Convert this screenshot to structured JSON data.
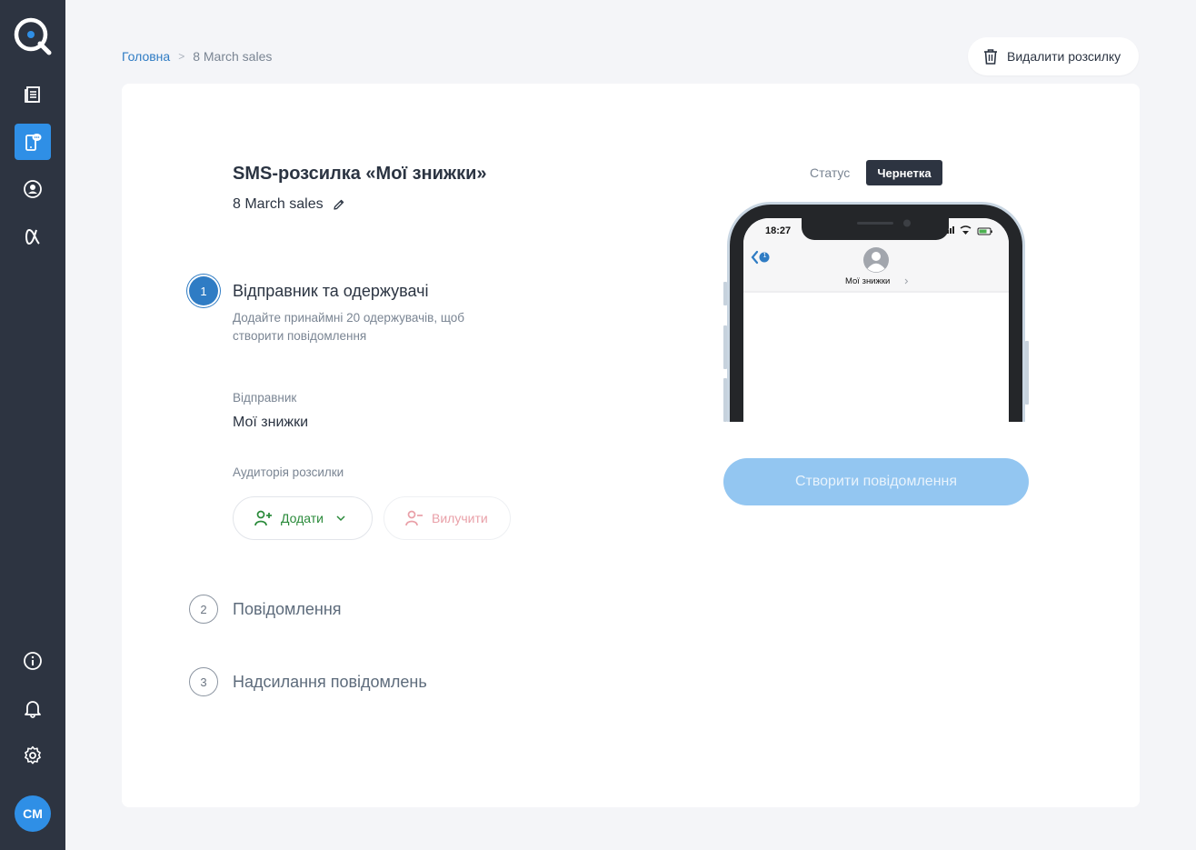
{
  "sidebar": {
    "items": [
      {
        "name": "campaigns",
        "icon": "newspaper-icon"
      },
      {
        "name": "sms",
        "icon": "sms-phone-icon",
        "active": true
      },
      {
        "name": "contacts",
        "icon": "contacts-icon"
      },
      {
        "name": "alpha",
        "icon": "alpha-icon"
      }
    ],
    "bottom": [
      {
        "name": "info",
        "icon": "info-icon"
      },
      {
        "name": "notifications",
        "icon": "bell-icon"
      },
      {
        "name": "settings",
        "icon": "gear-icon"
      }
    ],
    "avatar": "CM",
    "accent": "#2f8fe6"
  },
  "breadcrumb": {
    "home": "Головна",
    "current": "8 March sales"
  },
  "header": {
    "delete_label": "Видалити розсилку"
  },
  "campaign": {
    "title": "SMS-розсилка «Мої знижки»",
    "name": "8 March sales"
  },
  "steps": [
    {
      "number": "1",
      "title": "Відправник та одержувачі",
      "description": "Додайте принаймні 20 одержувачів, щоб створити повідомлення"
    },
    {
      "number": "2",
      "title": "Повідомлення"
    },
    {
      "number": "3",
      "title": "Надсилання повідомлень"
    }
  ],
  "sender": {
    "label": "Відправник",
    "value": "Мої знижки"
  },
  "audience": {
    "label": "Аудиторія розсилки",
    "add_label": "Додати",
    "exclude_label": "Вилучити"
  },
  "status": {
    "label": "Статус",
    "value": "Чернетка"
  },
  "phone": {
    "time": "18:27",
    "contact_name": "Мої знижки",
    "unread_count": "1"
  },
  "create_button": "Створити повідомлення"
}
